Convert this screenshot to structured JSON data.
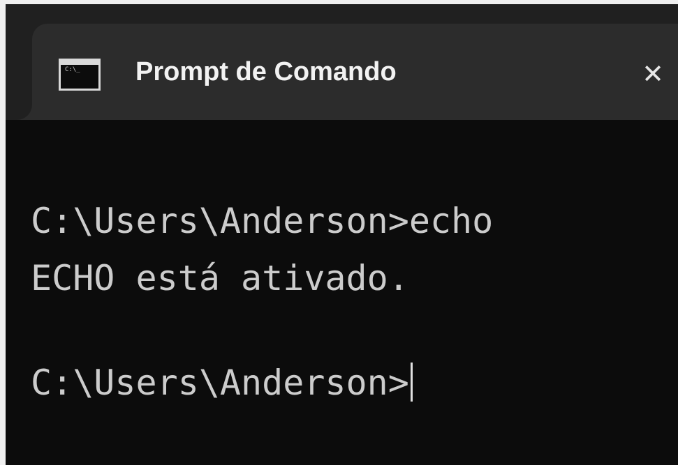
{
  "window": {
    "tab_title": "Prompt de Comando",
    "close_symbol": "✕",
    "tab_icon": "terminal-icon",
    "tab_icon_glyph": "C:\\_"
  },
  "terminal": {
    "lines": [
      "C:\\Users\\Anderson>echo",
      "ECHO está ativado.",
      "C:\\Users\\Anderson>"
    ]
  },
  "colors": {
    "background": "#0c0c0c",
    "tab_background": "#2c2c2c",
    "tabstrip_background": "#202020",
    "text": "#cccccc"
  }
}
